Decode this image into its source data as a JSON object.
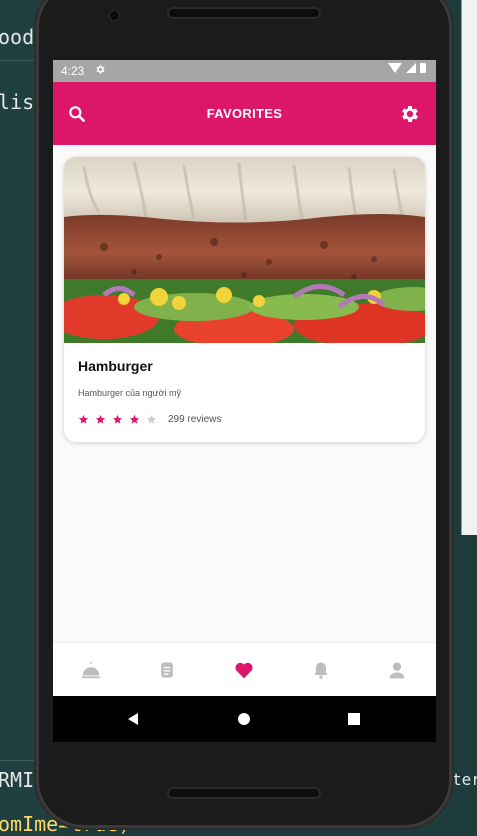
{
  "status_bar": {
    "time": "4:23"
  },
  "app_bar": {
    "title": "FAVORITES",
    "left_icon": "search-icon",
    "right_icon": "gear-icon"
  },
  "favorites": [
    {
      "name": "Hamburger",
      "description": "Hamburger của người mỹ",
      "rating": 4,
      "max_rating": 5,
      "reviews": "299 reviews"
    }
  ],
  "bottom_nav": {
    "items": [
      "food-cloche-icon",
      "document-icon",
      "heart-icon",
      "bell-icon",
      "profile-icon"
    ],
    "active_index": 2
  },
  "system_nav": [
    "back-icon",
    "home-icon",
    "recents-icon"
  ],
  "colors": {
    "accent": "#dc1769",
    "inactive": "#bdbdbd",
    "star_empty": "#cccccc"
  },
  "background_editor": {
    "lines": [
      "ood",
      "listF",
      "RMI",
      "omIme=true)",
      "ter"
    ]
  }
}
